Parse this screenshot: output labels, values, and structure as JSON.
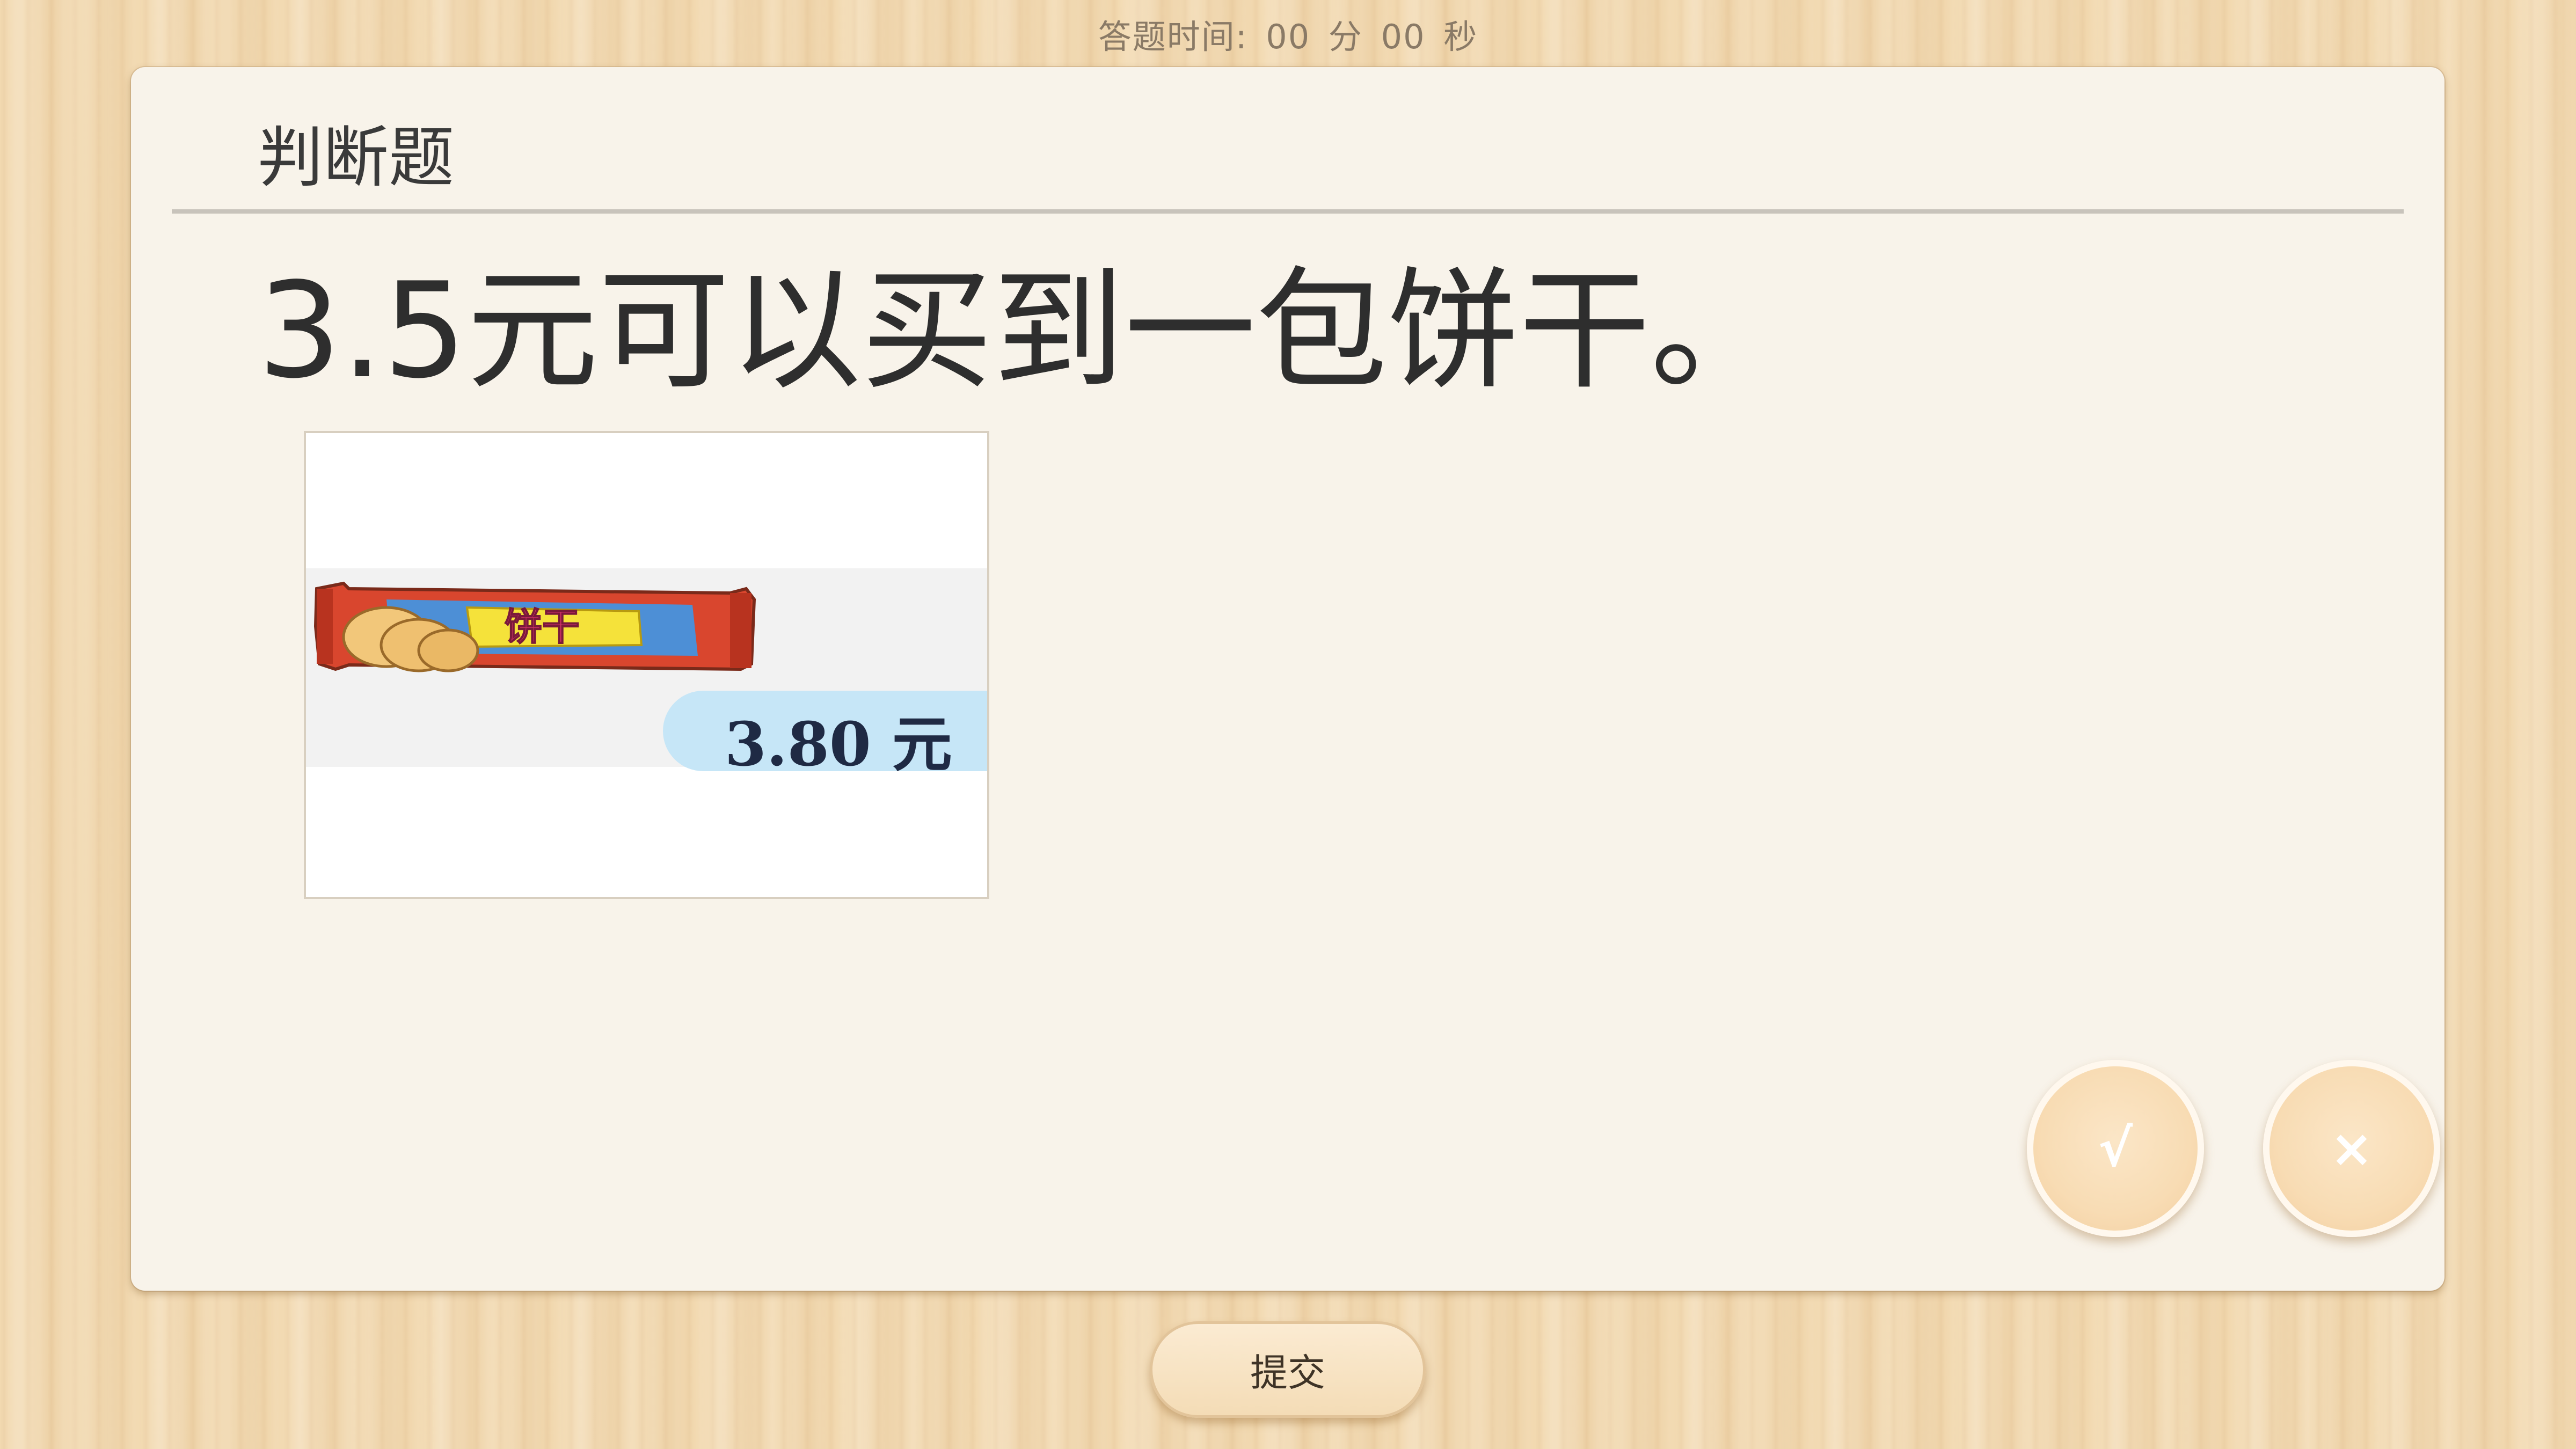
{
  "timer": {
    "label": "答题时间:",
    "minutes": "00",
    "minutes_unit": "分",
    "seconds": "00",
    "seconds_unit": "秒"
  },
  "card": {
    "title": "判断题",
    "question": "3.5元可以买到一包饼干。",
    "figure": {
      "package_label": "饼干",
      "price_text": "3.80 元"
    }
  },
  "answers": {
    "true_label": "√",
    "false_label": "×"
  },
  "submit": {
    "label": "提交"
  },
  "colors": {
    "background": "#f2d9b0",
    "card": "#f8f3ea",
    "answer_button": "#f8dcb4",
    "price_tag": "#c6e6f7"
  }
}
